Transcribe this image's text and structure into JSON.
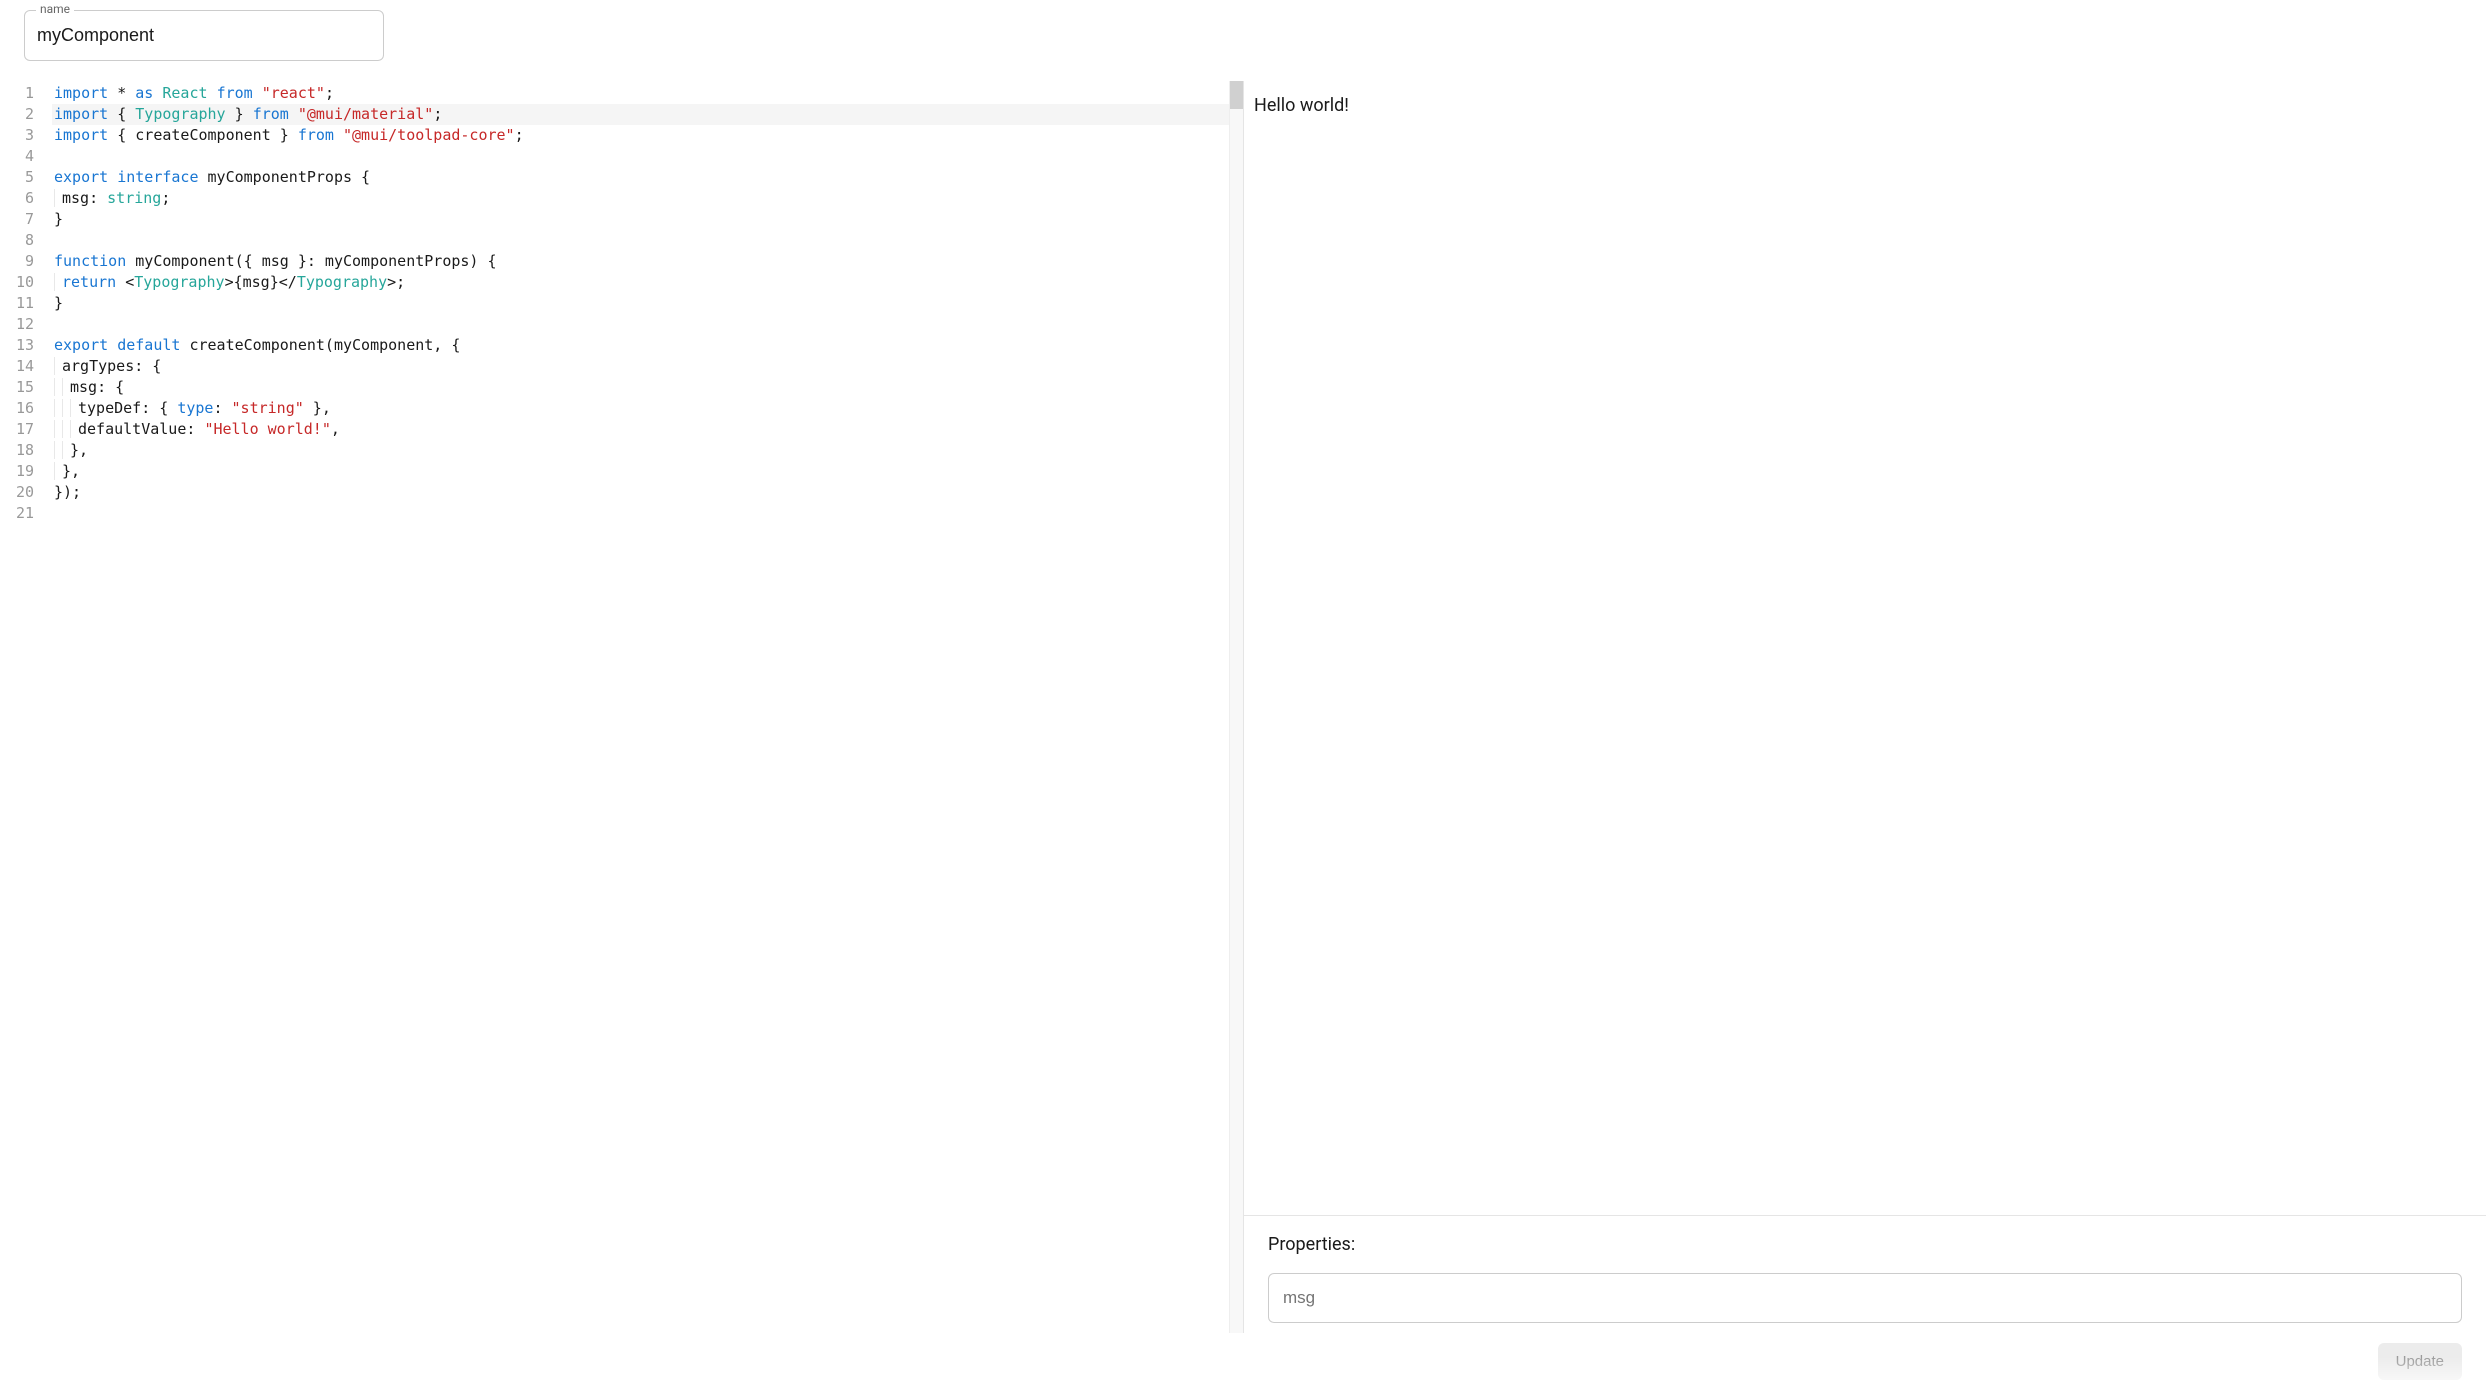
{
  "nameField": {
    "label": "name",
    "value": "myComponent"
  },
  "editor": {
    "highlightedLine": 2,
    "lines": [
      {
        "n": 1,
        "tokens": [
          {
            "t": "import",
            "c": "keyword"
          },
          {
            "t": " ",
            "c": "plain"
          },
          {
            "t": "*",
            "c": "plain"
          },
          {
            "t": " ",
            "c": "plain"
          },
          {
            "t": "as",
            "c": "keyword"
          },
          {
            "t": " ",
            "c": "plain"
          },
          {
            "t": "React",
            "c": "type"
          },
          {
            "t": " ",
            "c": "plain"
          },
          {
            "t": "from",
            "c": "keyword"
          },
          {
            "t": " ",
            "c": "plain"
          },
          {
            "t": "\"react\"",
            "c": "string"
          },
          {
            "t": ";",
            "c": "plain"
          }
        ]
      },
      {
        "n": 2,
        "tokens": [
          {
            "t": "import",
            "c": "keyword"
          },
          {
            "t": " { ",
            "c": "plain"
          },
          {
            "t": "Typography",
            "c": "type"
          },
          {
            "t": " } ",
            "c": "plain"
          },
          {
            "t": "from",
            "c": "keyword"
          },
          {
            "t": " ",
            "c": "plain"
          },
          {
            "t": "\"@mui/material\"",
            "c": "string"
          },
          {
            "t": ";",
            "c": "plain"
          }
        ]
      },
      {
        "n": 3,
        "tokens": [
          {
            "t": "import",
            "c": "keyword"
          },
          {
            "t": " { createComponent } ",
            "c": "plain"
          },
          {
            "t": "from",
            "c": "keyword"
          },
          {
            "t": " ",
            "c": "plain"
          },
          {
            "t": "\"@mui/toolpad-core\"",
            "c": "string"
          },
          {
            "t": ";",
            "c": "plain"
          }
        ]
      },
      {
        "n": 4,
        "tokens": []
      },
      {
        "n": 5,
        "tokens": [
          {
            "t": "export",
            "c": "keyword"
          },
          {
            "t": " ",
            "c": "plain"
          },
          {
            "t": "interface",
            "c": "keyword"
          },
          {
            "t": " myComponentProps {",
            "c": "plain"
          }
        ]
      },
      {
        "n": 6,
        "indent": 1,
        "tokens": [
          {
            "t": "msg: ",
            "c": "plain"
          },
          {
            "t": "string",
            "c": "type"
          },
          {
            "t": ";",
            "c": "plain"
          }
        ]
      },
      {
        "n": 7,
        "tokens": [
          {
            "t": "}",
            "c": "plain"
          }
        ]
      },
      {
        "n": 8,
        "tokens": []
      },
      {
        "n": 9,
        "tokens": [
          {
            "t": "function",
            "c": "keyword"
          },
          {
            "t": " myComponent({ msg }: myComponentProps) {",
            "c": "plain"
          }
        ]
      },
      {
        "n": 10,
        "indent": 1,
        "tokens": [
          {
            "t": "return",
            "c": "keyword"
          },
          {
            "t": " <",
            "c": "plain"
          },
          {
            "t": "Typography",
            "c": "type"
          },
          {
            "t": ">{msg}</",
            "c": "plain"
          },
          {
            "t": "Typography",
            "c": "type"
          },
          {
            "t": ">;",
            "c": "plain"
          }
        ]
      },
      {
        "n": 11,
        "tokens": [
          {
            "t": "}",
            "c": "plain"
          }
        ]
      },
      {
        "n": 12,
        "tokens": []
      },
      {
        "n": 13,
        "tokens": [
          {
            "t": "export",
            "c": "keyword"
          },
          {
            "t": " ",
            "c": "plain"
          },
          {
            "t": "default",
            "c": "keyword"
          },
          {
            "t": " createComponent(myComponent, {",
            "c": "plain"
          }
        ]
      },
      {
        "n": 14,
        "indent": 1,
        "tokens": [
          {
            "t": "argTypes: {",
            "c": "plain"
          }
        ]
      },
      {
        "n": 15,
        "indent": 2,
        "tokens": [
          {
            "t": "msg: {",
            "c": "plain"
          }
        ]
      },
      {
        "n": 16,
        "indent": 3,
        "tokens": [
          {
            "t": "typeDef: { ",
            "c": "plain"
          },
          {
            "t": "type",
            "c": "prop"
          },
          {
            "t": ": ",
            "c": "plain"
          },
          {
            "t": "\"string\"",
            "c": "string"
          },
          {
            "t": " },",
            "c": "plain"
          }
        ]
      },
      {
        "n": 17,
        "indent": 3,
        "tokens": [
          {
            "t": "defaultValue: ",
            "c": "plain"
          },
          {
            "t": "\"Hello world!\"",
            "c": "string"
          },
          {
            "t": ",",
            "c": "plain"
          }
        ]
      },
      {
        "n": 18,
        "indent": 2,
        "tokens": [
          {
            "t": "},",
            "c": "plain"
          }
        ]
      },
      {
        "n": 19,
        "indent": 1,
        "tokens": [
          {
            "t": "},",
            "c": "plain"
          }
        ]
      },
      {
        "n": 20,
        "tokens": [
          {
            "t": "});",
            "c": "plain"
          }
        ]
      },
      {
        "n": 21,
        "tokens": []
      }
    ]
  },
  "preview": {
    "output": "Hello world!"
  },
  "properties": {
    "title": "Properties:",
    "fields": [
      {
        "name": "msg",
        "value": ""
      }
    ]
  },
  "actions": {
    "updateLabel": "Update"
  }
}
